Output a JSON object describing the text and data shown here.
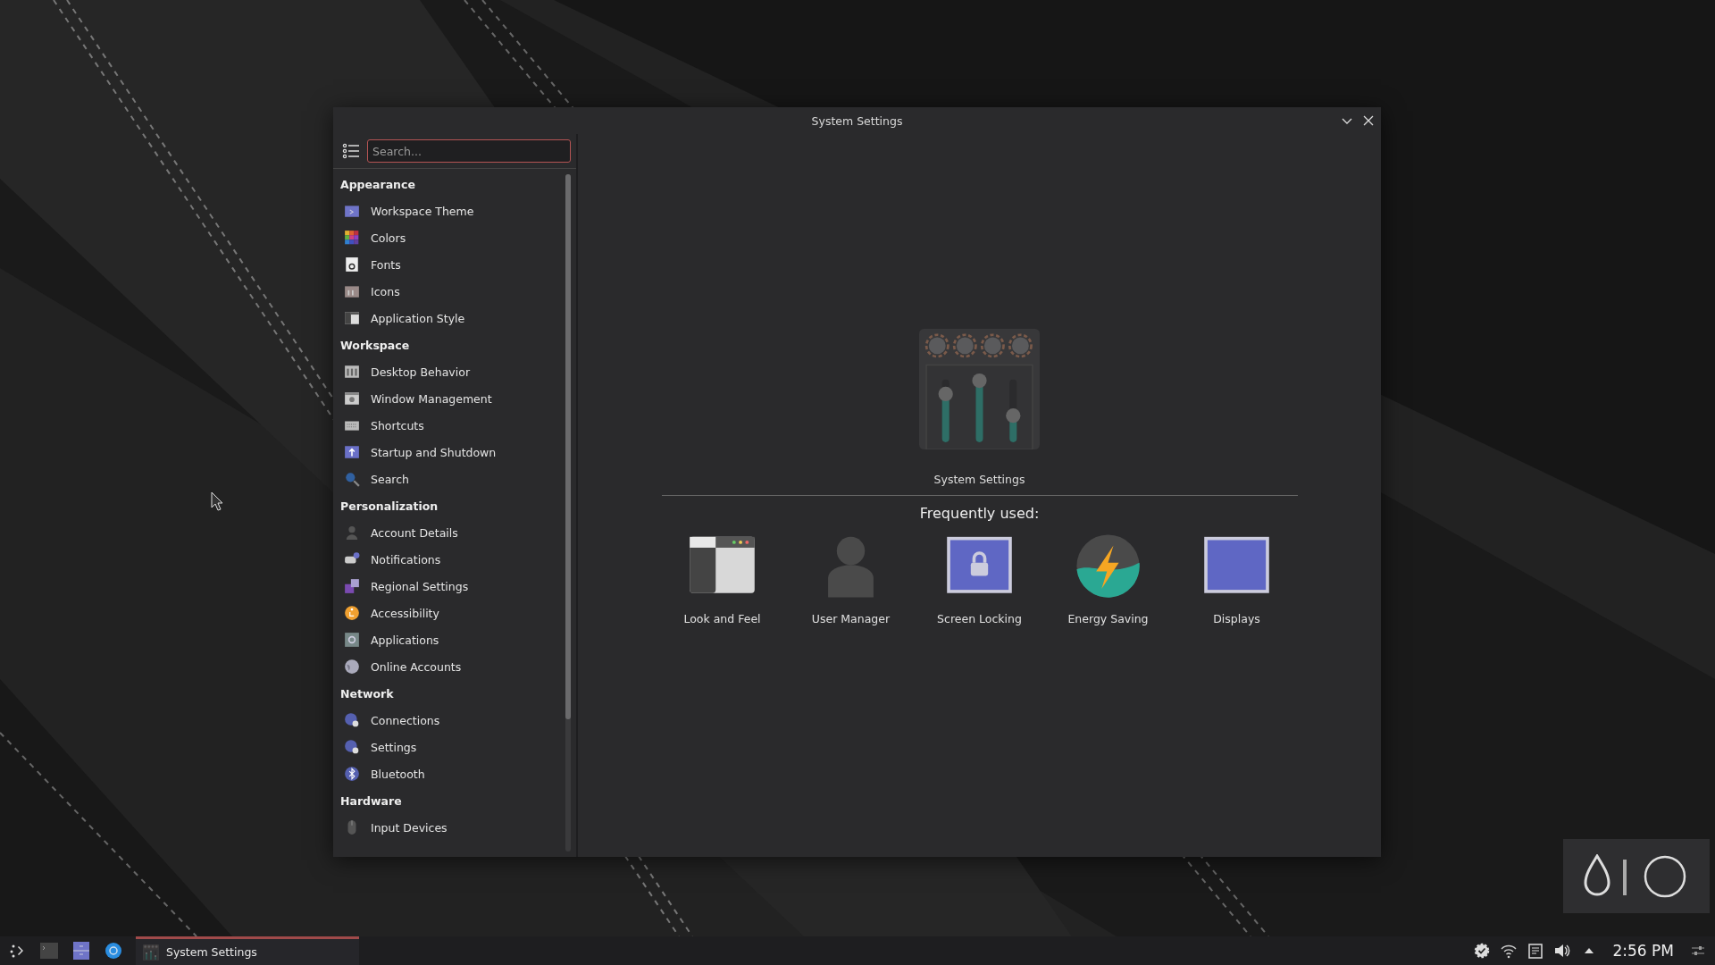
{
  "window": {
    "title": "System Settings"
  },
  "sidebar": {
    "search": {
      "placeholder": "Search..."
    },
    "groups": [
      {
        "label": "Appearance",
        "items": [
          {
            "label": "Workspace Theme"
          },
          {
            "label": "Colors"
          },
          {
            "label": "Fonts"
          },
          {
            "label": "Icons"
          },
          {
            "label": "Application Style"
          }
        ]
      },
      {
        "label": "Workspace",
        "items": [
          {
            "label": "Desktop Behavior"
          },
          {
            "label": "Window Management"
          },
          {
            "label": "Shortcuts"
          },
          {
            "label": "Startup and Shutdown"
          },
          {
            "label": "Search"
          }
        ]
      },
      {
        "label": "Personalization",
        "items": [
          {
            "label": "Account Details"
          },
          {
            "label": "Notifications"
          },
          {
            "label": "Regional Settings"
          },
          {
            "label": "Accessibility"
          },
          {
            "label": "Applications"
          },
          {
            "label": "Online Accounts"
          }
        ]
      },
      {
        "label": "Network",
        "items": [
          {
            "label": "Connections"
          },
          {
            "label": "Settings"
          },
          {
            "label": "Bluetooth"
          }
        ]
      },
      {
        "label": "Hardware",
        "items": [
          {
            "label": "Input Devices"
          }
        ]
      }
    ]
  },
  "main": {
    "caption": "System Settings",
    "frequent_title": "Frequently used:",
    "frequent": [
      {
        "label": "Look and Feel"
      },
      {
        "label": "User Manager"
      },
      {
        "label": "Screen Locking"
      },
      {
        "label": "Energy Saving"
      },
      {
        "label": "Displays"
      }
    ]
  },
  "taskbar": {
    "tasks": [
      {
        "label": "System Settings",
        "selected": true
      }
    ],
    "clock": "2:56 PM"
  }
}
